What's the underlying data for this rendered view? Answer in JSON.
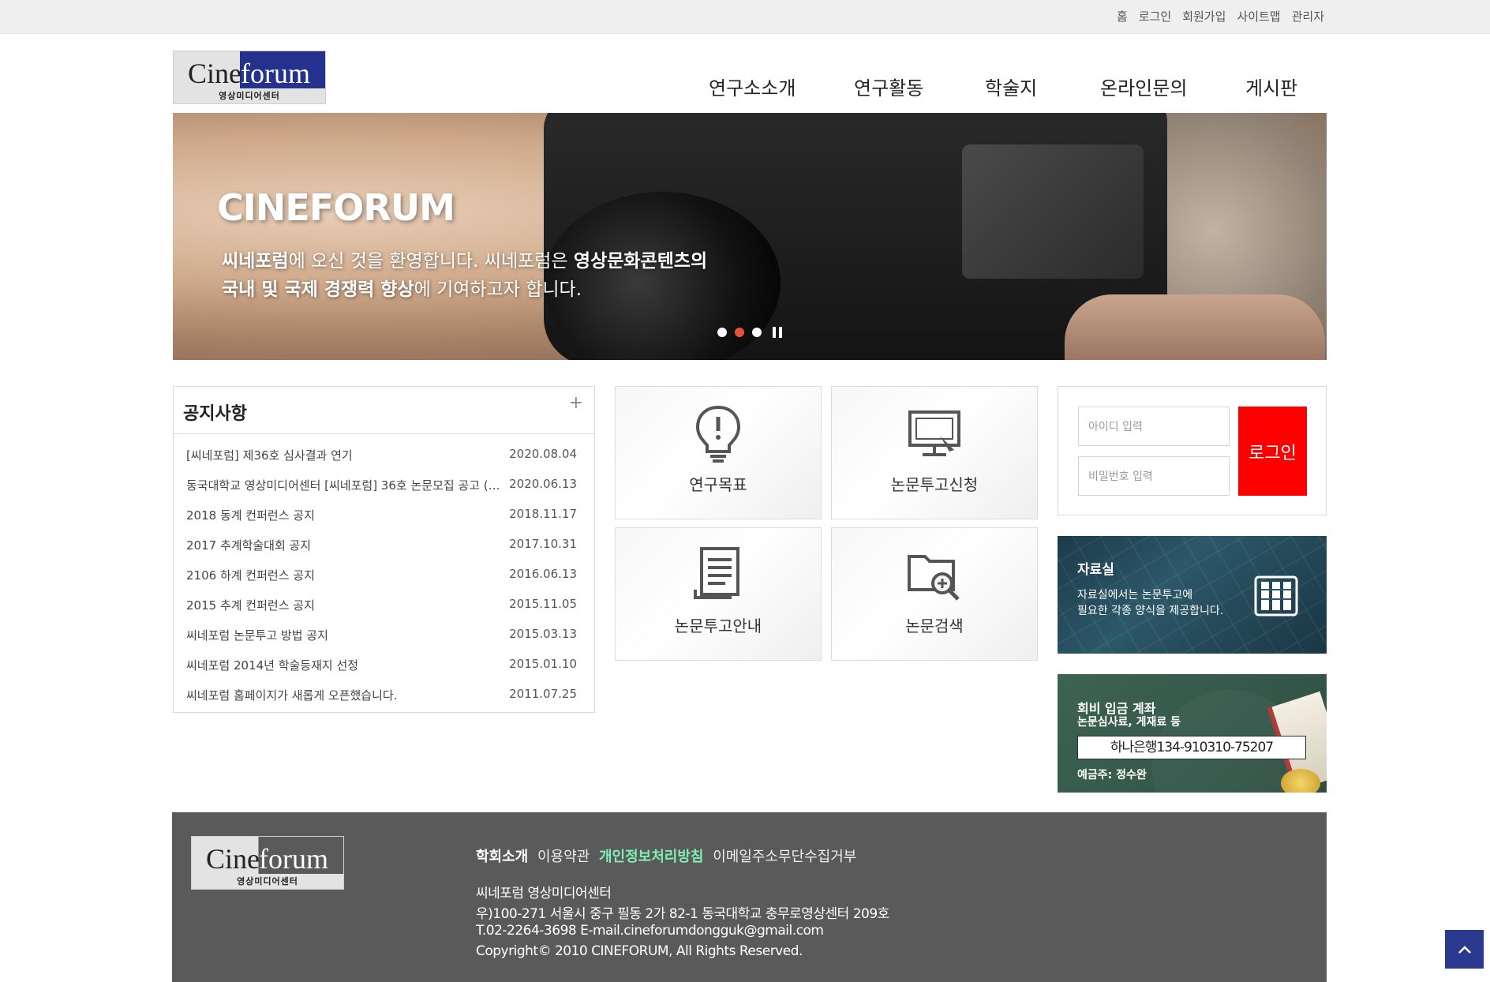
{
  "utility_links": [
    "홈",
    "로그인",
    "회원가입",
    "사이트맵",
    "관리자"
  ],
  "logo": {
    "word1": "Cine",
    "word2": "forum",
    "subtitle": "영상미디어센터"
  },
  "nav": [
    "연구소소개",
    "연구활동",
    "학술지",
    "온라인문의",
    "게시판"
  ],
  "banner": {
    "title": "CINEFORUM",
    "line1_parts": [
      "씨네포럼",
      "에 오신 것을 환영합니다. 씨네포럼은 ",
      "영상문화콘텐츠의"
    ],
    "line2_parts": [
      "국내 및 국제 경쟁력 향상",
      "에 기여하고자 합니다."
    ],
    "active_slide": 2,
    "slide_count": 3
  },
  "notice": {
    "title": "공지사항",
    "more": "+",
    "items": [
      {
        "title": "[씨네포럼] 제36호 심사결과 연기",
        "date": "2020.08.04"
      },
      {
        "title": "동국대학교 영상미디어센터 [씨네포럼] 36호 논문모집 공고 (2...",
        "date": "2020.06.13"
      },
      {
        "title": "2018 동계 컨퍼런스 공지",
        "date": "2018.11.17"
      },
      {
        "title": "2017 추계학술대회 공지",
        "date": "2017.10.31"
      },
      {
        "title": "2106 하계 컨퍼런스 공지",
        "date": "2016.06.13"
      },
      {
        "title": "2015 추계 컨퍼런스 공지",
        "date": "2015.11.05"
      },
      {
        "title": "씨네포럼 논문투고 방법 공지",
        "date": "2015.03.13"
      },
      {
        "title": "씨네포럼 2014년 학술등재지 선정",
        "date": "2015.01.10"
      },
      {
        "title": "씨네포럼 홈페이지가 새롭게 오픈했습니다.",
        "date": "2011.07.25"
      }
    ]
  },
  "quick_menu": {
    "goal": {
      "label": "연구목표",
      "icon": "lightbulb-icon"
    },
    "submit": {
      "label": "논문투고신청",
      "icon": "monitor-icon"
    },
    "guide": {
      "label": "논문투고안내",
      "icon": "document-icon"
    },
    "search": {
      "label": "논문검색",
      "icon": "folder-search-icon"
    }
  },
  "login": {
    "id_placeholder": "아이디 입력",
    "pw_placeholder": "비밀번호 입력",
    "button": "로그인"
  },
  "archive_banner": {
    "title": "자료실",
    "line1": "자료실에서는 논문투고에",
    "line2": "필요한 각종 양식을 제공합니다."
  },
  "fee_banner": {
    "title": "회비 입금 계좌",
    "subtitle": "논문심사료, 게재료 등",
    "account": "하나은행134-910310-75207",
    "owner": "예금주: 정수완"
  },
  "footer": {
    "links": [
      "학회소개",
      "이용약관",
      "개인정보처리방침",
      "이메일주소무단수집거부"
    ],
    "org": "씨네포럼 영상미디어센터",
    "address": "우)100-271 서울시 중구 필동 2가 82-1 동국대학교 충무로영상센터 209호",
    "contact": "T.02-2264-3698 E-mail.cineforumdongguk@gmail.com",
    "copyright": "Copyright© 2010 CINEFORUM, All Rights Reserved."
  },
  "colors": {
    "brand_blue": "#24318f",
    "login_red": "#ff0000",
    "footer_bg": "#5a5a5a",
    "policy_green": "#7ff0b2"
  }
}
